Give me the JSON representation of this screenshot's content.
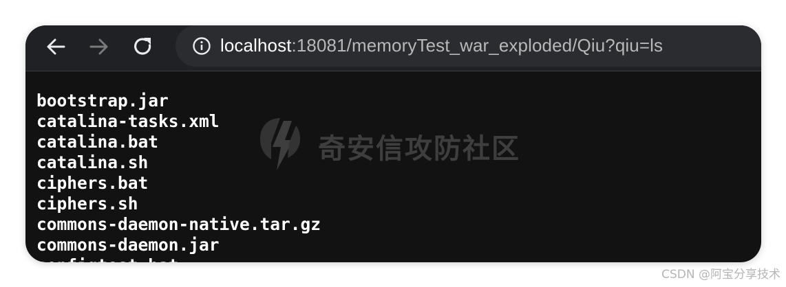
{
  "browser": {
    "url_host": "localhost",
    "url_rest": ":18081/memoryTest_war_exploded/Qiu?qiu=ls",
    "icons": {
      "back": "back-arrow-icon",
      "forward": "forward-arrow-icon",
      "reload": "reload-icon",
      "site_info": "info-icon"
    }
  },
  "page": {
    "files": [
      "bootstrap.jar",
      "catalina-tasks.xml",
      "catalina.bat",
      "catalina.sh",
      "ciphers.bat",
      "ciphers.sh",
      "commons-daemon-native.tar.gz",
      "commons-daemon.jar",
      "configtest.bat"
    ]
  },
  "watermark": {
    "text": "奇安信攻防社区"
  },
  "credit": {
    "text": "CSDN @阿宝分享技术"
  },
  "colors": {
    "page_background": "#121212",
    "toolbar_background": "#202124",
    "omnibox_background": "#2b2c30",
    "text": "#ffffff"
  }
}
